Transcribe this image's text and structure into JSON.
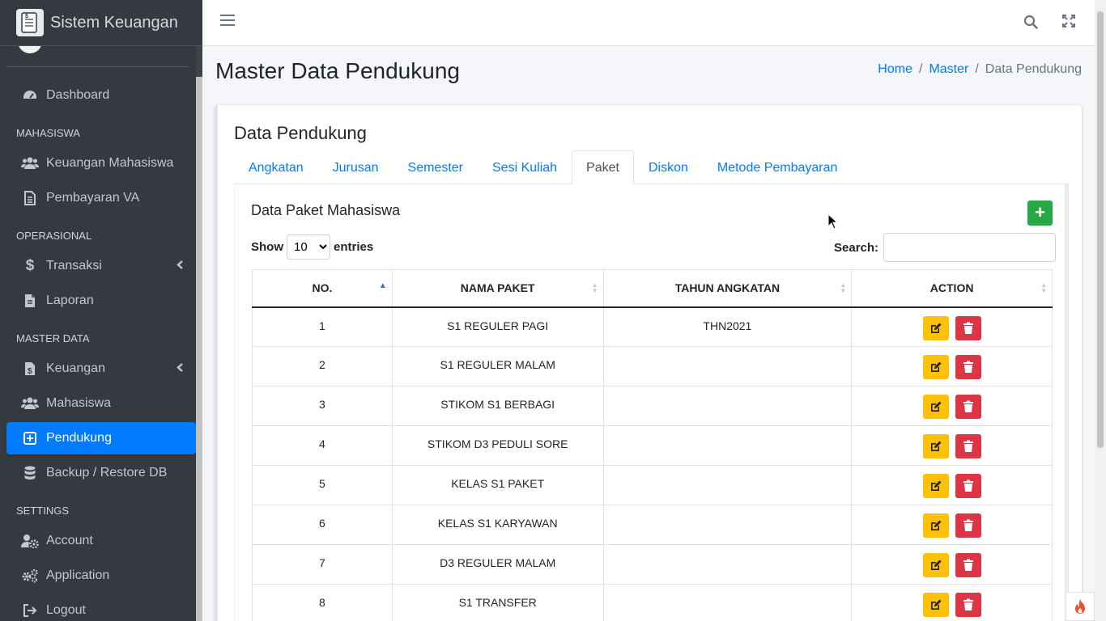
{
  "brand": {
    "title": "Sistem Keuangan",
    "logo_icon": "receipt-dollar-icon"
  },
  "sidebar": {
    "sections": [
      {
        "type": "item",
        "label": "Dashboard",
        "icon": "tachometer-icon"
      },
      {
        "type": "header",
        "label": "MAHASISWA"
      },
      {
        "type": "item",
        "label": "Keuangan Mahasiswa",
        "icon": "users-icon"
      },
      {
        "type": "item",
        "label": "Pembayaran VA",
        "icon": "file-invoice-icon"
      },
      {
        "type": "header",
        "label": "OPERASIONAL"
      },
      {
        "type": "item",
        "label": "Transaksi",
        "icon": "dollar-icon",
        "caret": true
      },
      {
        "type": "item",
        "label": "Laporan",
        "icon": "file-icon"
      },
      {
        "type": "header",
        "label": "MASTER DATA"
      },
      {
        "type": "item",
        "label": "Keuangan",
        "icon": "file-dollar-icon",
        "caret": true
      },
      {
        "type": "item",
        "label": "Mahasiswa",
        "icon": "users-icon"
      },
      {
        "type": "item",
        "label": "Pendukung",
        "icon": "plus-square-icon",
        "active": true
      },
      {
        "type": "item",
        "label": "Backup / Restore DB",
        "icon": "database-icon"
      },
      {
        "type": "header",
        "label": "SETTINGS"
      },
      {
        "type": "item",
        "label": "Account",
        "icon": "user-cog-icon"
      },
      {
        "type": "item",
        "label": "Application",
        "icon": "cogs-icon"
      },
      {
        "type": "item",
        "label": "Logout",
        "icon": "sign-out-icon"
      }
    ]
  },
  "header": {
    "page_title": "Master Data Pendukung",
    "breadcrumb": {
      "home": "Home",
      "master": "Master",
      "current": "Data Pendukung",
      "sep": "/"
    }
  },
  "card": {
    "title": "Data Pendukung",
    "tabs": [
      "Angkatan",
      "Jurusan",
      "Semester",
      "Sesi Kuliah",
      "Paket",
      "Diskon",
      "Metode Pembayaran"
    ],
    "active_tab": "Paket"
  },
  "inner": {
    "title": "Data Paket Mahasiswa",
    "add_label": "+",
    "show_label": "Show",
    "entries_label": "entries",
    "page_size": "10",
    "search_label": "Search:",
    "search_value": ""
  },
  "table": {
    "columns": [
      "NO.",
      "NAMA PAKET",
      "TAHUN ANGKATAN",
      "ACTION"
    ],
    "rows": [
      {
        "no": "1",
        "nama": "S1 REGULER PAGI",
        "tahun": "THN2021"
      },
      {
        "no": "2",
        "nama": "S1 REGULER MALAM",
        "tahun": ""
      },
      {
        "no": "3",
        "nama": "STIKOM S1 BERBAGI",
        "tahun": ""
      },
      {
        "no": "4",
        "nama": "STIKOM D3 PEDULI SORE",
        "tahun": ""
      },
      {
        "no": "5",
        "nama": "KELAS S1 PAKET",
        "tahun": ""
      },
      {
        "no": "6",
        "nama": "KELAS S1 KARYAWAN",
        "tahun": ""
      },
      {
        "no": "7",
        "nama": "D3 REGULER MALAM",
        "tahun": ""
      },
      {
        "no": "8",
        "nama": "S1 TRANSFER",
        "tahun": ""
      }
    ]
  },
  "colors": {
    "primary": "#007bff",
    "success": "#28a745",
    "warning": "#ffc107",
    "danger": "#dc3545",
    "sidebar": "#343a40"
  }
}
